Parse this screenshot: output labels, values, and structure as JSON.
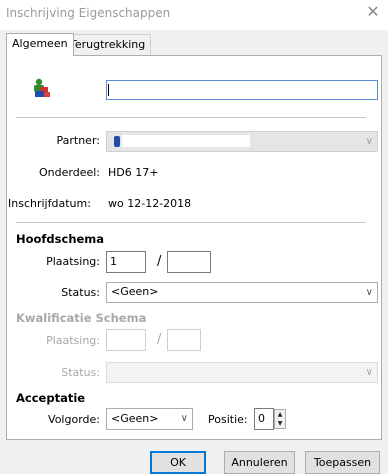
{
  "window": {
    "title": "Inschrijving Eigenschappen",
    "close_glyph": "✕"
  },
  "tabs": [
    {
      "label": "Algemeen",
      "active": true
    },
    {
      "label": "Terugtrekking",
      "active": false
    }
  ],
  "general": {
    "icon": "user-group-icon",
    "name_value": "",
    "partner_label": "Partner:",
    "partner_value": "",
    "onderdeel_label": "Onderdeel:",
    "onderdeel_value": "HD6 17+",
    "inschrijfdatum_label": "Inschrijfdatum:",
    "inschrijfdatum_value": "wo 12-12-2018"
  },
  "hoofdschema": {
    "header": "Hoofdschema",
    "plaatsing_label": "Plaatsing:",
    "plaatsing_value": "1",
    "slash": "/",
    "plaatsing_total": "",
    "status_label": "Status:",
    "status_value": "<Geen>"
  },
  "kwalificatie": {
    "header": "Kwalificatie Schema",
    "plaatsing_label": "Plaatsing:",
    "plaatsing_value": "",
    "slash": "/",
    "plaatsing_total": "",
    "status_label": "Status:",
    "status_value": ""
  },
  "acceptatie": {
    "header": "Acceptatie",
    "volgorde_label": "Volgorde:",
    "volgorde_value": "<Geen>",
    "positie_label": "Positie:",
    "positie_value": "0"
  },
  "buttons": {
    "ok": "OK",
    "cancel": "Annuleren",
    "apply": "Toepassen"
  }
}
